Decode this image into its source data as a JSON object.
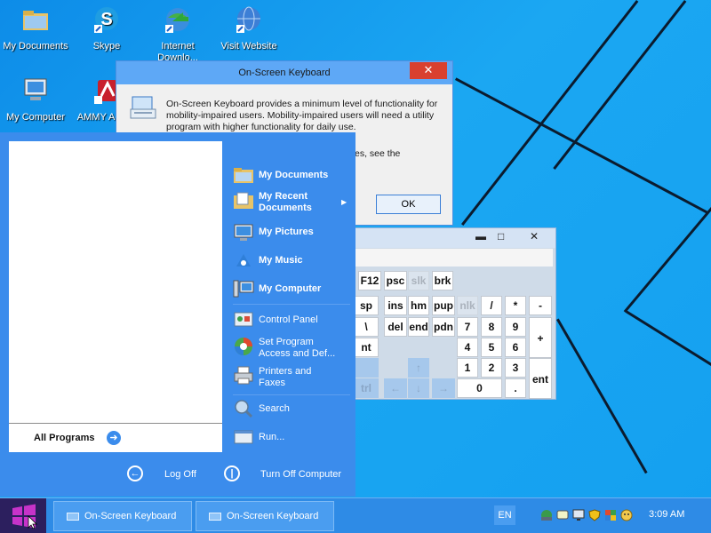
{
  "desktop": {
    "icons": [
      {
        "label": "My Documents"
      },
      {
        "label": "Skype"
      },
      {
        "label": "Internet Downlo..."
      },
      {
        "label": "Visit Website"
      },
      {
        "label": "My Computer"
      },
      {
        "label": "AMMY Admin"
      }
    ]
  },
  "dialog": {
    "title": "On-Screen Keyboard",
    "close_label": "✕",
    "message": "On-Screen Keyboard provides a minimum level of functionality for mobility-impaired users. Mobility-impaired users will need a utility program with higher functionality for daily use.",
    "message_tail": "es, see the",
    "ok_label": "OK"
  },
  "keyboard": {
    "minimize": "▬",
    "maximize": "□",
    "close": "✕",
    "keys": [
      "F12",
      "psc",
      "slk",
      "brk",
      "sp",
      "ins",
      "hm",
      "pup",
      "nlk",
      "/",
      "*",
      "-",
      "\\",
      "del",
      "end",
      "pdn",
      "7",
      "8",
      "9",
      "+",
      "nt",
      "4",
      "5",
      "6",
      "1",
      "2",
      "3",
      "ent",
      "0",
      ".",
      "↑",
      "←",
      "↓",
      "→",
      "trl"
    ]
  },
  "start_menu": {
    "all_programs": "All Programs",
    "items": [
      {
        "label": "My Documents",
        "icon": "folder-icon"
      },
      {
        "label": "My Recent Documents",
        "icon": "recent-docs-icon"
      },
      {
        "label": "My Pictures",
        "icon": "pictures-icon"
      },
      {
        "label": "My Music",
        "icon": "music-icon"
      },
      {
        "label": "My Computer",
        "icon": "computer-icon"
      },
      {
        "label": "Control Panel",
        "icon": "control-panel-icon"
      },
      {
        "label": "Set Program Access and Def...",
        "icon": "program-access-icon"
      },
      {
        "label": "Printers and Faxes",
        "icon": "printer-icon"
      },
      {
        "label": "Search",
        "icon": "search-icon"
      },
      {
        "label": "Run...",
        "icon": "run-icon"
      }
    ],
    "log_off": "Log Off",
    "turn_off": "Turn Off Computer"
  },
  "taskbar": {
    "buttons": [
      {
        "label": "On-Screen Keyboard"
      },
      {
        "label": "On-Screen Keyboard"
      }
    ],
    "language": "EN",
    "clock": "3:09 AM"
  },
  "colors": {
    "taskbar": "#2e8be6",
    "start_menu": "#3b8cec",
    "close_red": "#d9402f"
  }
}
